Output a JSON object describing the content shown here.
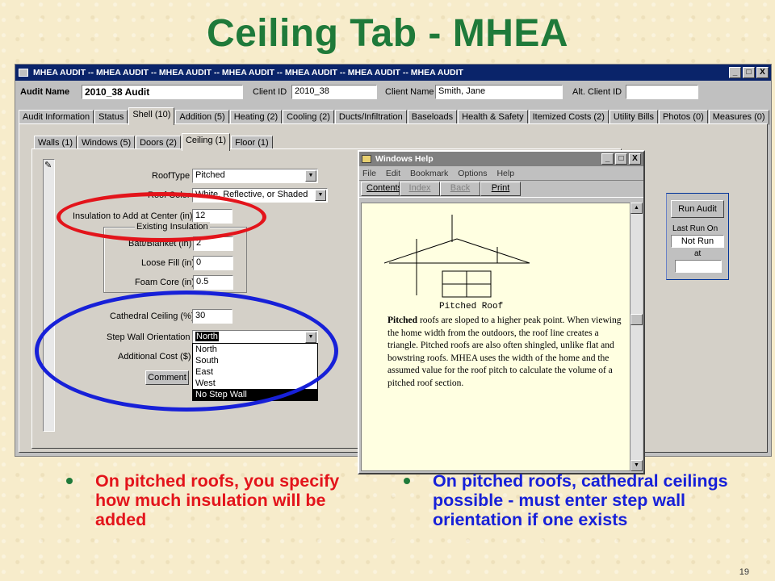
{
  "slide": {
    "title": "Ceiling Tab - MHEA",
    "page_number": "19",
    "bullets": [
      "On pitched roofs, you specify how much insulation will be added",
      "On pitched roofs, cathedral ceilings possible - must enter step wall orientation if one exists"
    ],
    "colors": {
      "title": "#1f7a3a",
      "bullet1": "#e3141b",
      "bullet2": "#1720d8",
      "oval_red": "#e3141b",
      "oval_blue": "#1720d8"
    }
  },
  "app": {
    "title": "MHEA AUDIT -- MHEA AUDIT -- MHEA AUDIT -- MHEA AUDIT -- MHEA AUDIT -- MHEA AUDIT -- MHEA AUDIT",
    "window_buttons": [
      "_",
      "□",
      "X"
    ],
    "header": {
      "audit_name_label": "Audit Name",
      "audit_name_value": "2010_38 Audit",
      "client_id_label": "Client ID",
      "client_id_value": "2010_38",
      "client_name_label": "Client Name",
      "client_name_value": "Smith, Jane",
      "alt_client_id_label": "Alt. Client ID",
      "alt_client_id_value": ""
    },
    "tabs": [
      "Audit Information",
      "Status",
      "Shell (10)",
      "Addition (5)",
      "Heating (2)",
      "Cooling (2)",
      "Ducts/Infiltration",
      "Baseloads",
      "Health & Safety",
      "Itemized Costs (2)",
      "Utility Bills",
      "Photos (0)",
      "Measures (0)"
    ],
    "active_tab": "Shell (10)",
    "subtabs": [
      "Walls (1)",
      "Windows (5)",
      "Doors (2)",
      "Ceiling (1)",
      "Floor (1)"
    ],
    "active_subtab": "Ceiling (1)",
    "form": {
      "roof_type_label": "RoofType",
      "roof_type_value": "Pitched",
      "roof_color_label": "Roof Color",
      "roof_color_value": "White, Reflective, or Shaded",
      "insulation_label": "Insulation to Add at Center (in)",
      "insulation_value": "12",
      "existing_group_label": "Existing Insulation",
      "batt_label": "Batt/Blanket (in)",
      "batt_value": "2",
      "loose_label": "Loose Fill (in)",
      "loose_value": "0",
      "foam_label": "Foam Core (in)",
      "foam_value": "0.5",
      "cathedral_label": "Cathedral Ceiling (%)",
      "cathedral_value": "30",
      "step_wall_label": "Step Wall Orientation",
      "step_wall_value": "North",
      "step_wall_options": [
        "North",
        "South",
        "East",
        "West",
        "No Step Wall"
      ],
      "step_wall_highlighted": "No Step Wall",
      "additional_cost_label": "Additional Cost ($)",
      "comment_button": "Comment"
    },
    "run_audit": {
      "button": "Run Audit",
      "last_run_label": "Last Run On",
      "last_run_value": "Not Run",
      "at_label": "at",
      "at_value": ""
    }
  },
  "help": {
    "title": "Windows Help",
    "menu": [
      "File",
      "Edit",
      "Bookmark",
      "Options",
      "Help"
    ],
    "toolbar": [
      "Contents",
      "Index",
      "Back",
      "Print"
    ],
    "diagram_caption": "Pitched Roof",
    "term": "Pitched",
    "text": " roofs are sloped to a higher peak point. When viewing the home width from the outdoors, the roof line creates a triangle. Pitched roofs are also often shingled, unlike flat and bowstring roofs. MHEA uses the width of the home and the assumed value for the roof pitch to calculate the volume of a pitched roof section."
  }
}
